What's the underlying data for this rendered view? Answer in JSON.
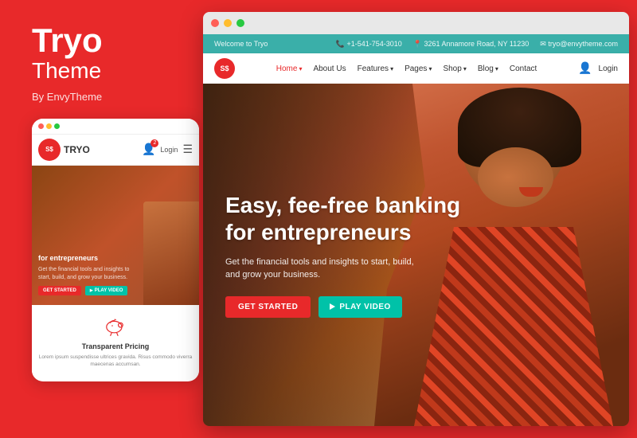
{
  "brand": {
    "name": "Tryo",
    "subtitle": "Theme",
    "by": "By EnvyTheme"
  },
  "mobile": {
    "logo": "S$",
    "logo_text": "TRYO",
    "login_label": "Login",
    "hero_title": "for entrepreneurs",
    "hero_subtitle": "Get the financial tools and insights to start, build, and grow your business.",
    "btn_get": "GET STARTED",
    "btn_play": "PLAY VIDEO",
    "pricing_title": "Transparent Pricing",
    "pricing_text": "Lorem ipsum suspendisse ultrices gravida. Risus commodo viverra maecenas accumsan."
  },
  "topbar": {
    "welcome": "Welcome to Tryo",
    "phone": "+1-541-754-3010",
    "address": "3261 Annamore Road, NY 11230",
    "email": "tryo@envytheme.com"
  },
  "navbar": {
    "logo": "S$",
    "items": [
      {
        "label": "Home",
        "active": true,
        "has_dropdown": true
      },
      {
        "label": "About Us",
        "active": false,
        "has_dropdown": false
      },
      {
        "label": "Features",
        "active": false,
        "has_dropdown": true
      },
      {
        "label": "Pages",
        "active": false,
        "has_dropdown": true
      },
      {
        "label": "Shop",
        "active": false,
        "has_dropdown": true
      },
      {
        "label": "Blog",
        "active": false,
        "has_dropdown": true
      },
      {
        "label": "Contact",
        "active": false,
        "has_dropdown": false
      }
    ],
    "login_label": "Login"
  },
  "hero": {
    "title": "Easy, fee-free banking for entrepreneurs",
    "description": "Get the financial tools and insights to start, build, and grow your business.",
    "btn_get": "GET STARTED",
    "btn_play": "PLAY VIDEO"
  },
  "browser_dots": {
    "red": "#ff5f57",
    "yellow": "#ffbd2e",
    "green": "#28c941"
  },
  "colors": {
    "primary_red": "#e8292a",
    "teal": "#3aafa9",
    "teal_btn": "#00c2a8"
  }
}
